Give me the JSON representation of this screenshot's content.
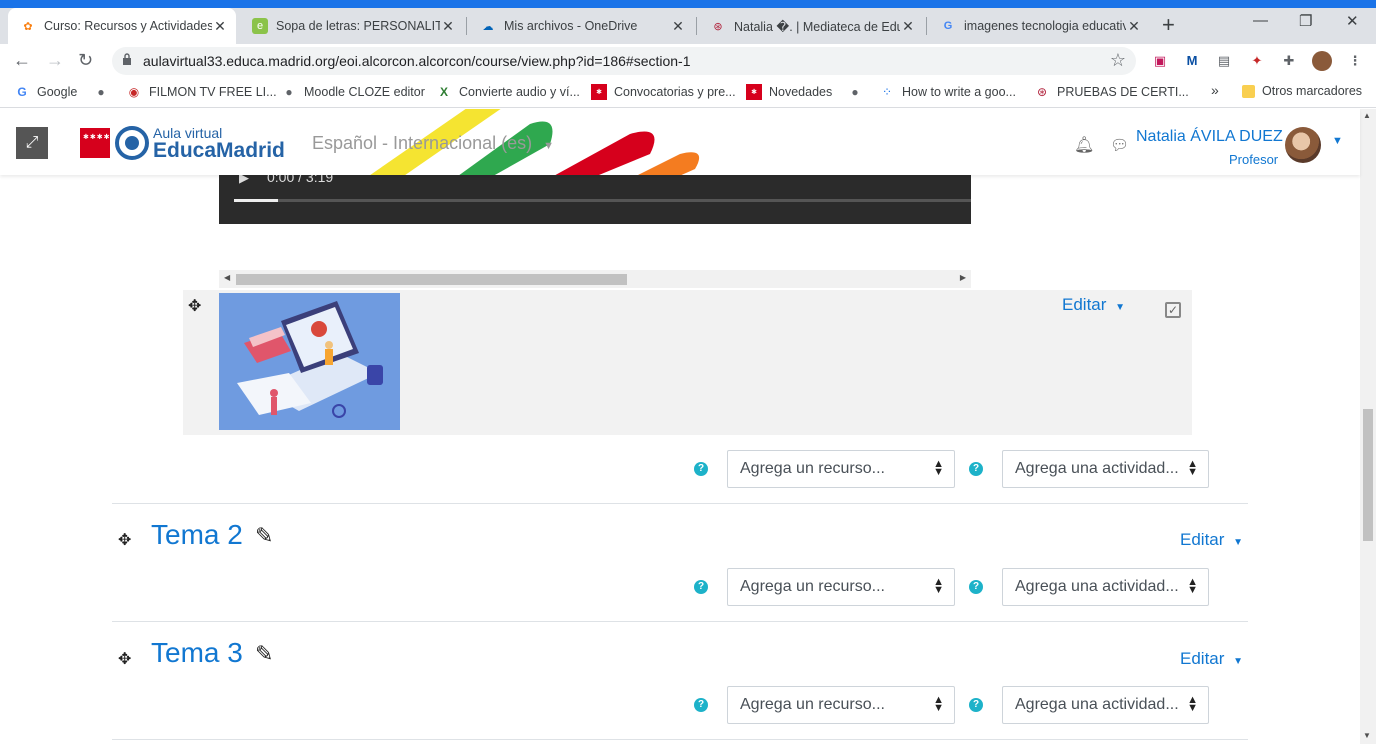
{
  "tabs": [
    {
      "title": "Curso: Recursos y Actividades",
      "icon": "moodle-icon",
      "active": true
    },
    {
      "title": "Sopa de letras: PERSONALITY A",
      "icon": "educaplay-icon"
    },
    {
      "title": "Mis archivos - OneDrive",
      "icon": "onedrive-icon"
    },
    {
      "title": "Natalia �. | Mediateca de Educ",
      "icon": "mediateca-icon"
    },
    {
      "title": "imagenes tecnologia educativa",
      "icon": "google-icon"
    }
  ],
  "address": {
    "url": "aulavirtual33.educa.madrid.org/eoi.alcorcon.alcorcon/course/view.php?id=186#section-1"
  },
  "bookmarks": [
    {
      "label": "Google",
      "icon": "google-icon"
    },
    {
      "label": "",
      "icon": "globe-icon"
    },
    {
      "label": "FILMON TV FREE LI...",
      "icon": "filmon-icon"
    },
    {
      "label": "Moodle CLOZE editor",
      "icon": "globe-icon"
    },
    {
      "label": "Convierte audio y ví...",
      "icon": "convert-icon"
    },
    {
      "label": "Convocatorias y pre...",
      "icon": "comunidad-icon"
    },
    {
      "label": "Novedades",
      "icon": "comunidad-icon"
    },
    {
      "label": "",
      "icon": "globe-icon"
    },
    {
      "label": "How to write a goo...",
      "icon": "apps-icon"
    },
    {
      "label": "PRUEBAS DE CERTI...",
      "icon": "mediateca-icon"
    }
  ],
  "bookmarks_more": "»",
  "other_bookmarks": "Otros marcadores",
  "header": {
    "logo_small": "Aula virtual",
    "logo_big": "EducaMadrid",
    "language": "Español - Internacional (es)",
    "user_name": "Natalia ÁVILA DUEZ",
    "user_role": "Profesor"
  },
  "video": {
    "time": "0:00 / 3:19",
    "progress": 0.06
  },
  "activity": {
    "edit_label": "Editar",
    "image_alt": "tecnologia educativa"
  },
  "add_resource": "Agrega un recurso...",
  "add_activity": "Agrega una actividad...",
  "sections": [
    {
      "title": "Tema 2",
      "edit_label": "Editar"
    },
    {
      "title": "Tema 3",
      "edit_label": "Editar"
    }
  ],
  "colors": {
    "link": "#1177d1",
    "help": "#1db2c9",
    "chrome_accent": "#1a73e8"
  }
}
